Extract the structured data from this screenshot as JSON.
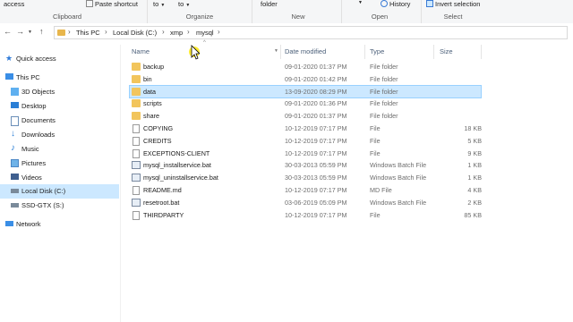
{
  "ribbon": {
    "access": "access",
    "paste_shortcut": "Paste shortcut",
    "to1": "to",
    "to2": "to",
    "folder": "folder",
    "history": "History",
    "invert_selection": "Invert selection",
    "groups": {
      "clipboard": "Clipboard",
      "organize": "Organize",
      "new": "New",
      "open": "Open",
      "select": "Select"
    }
  },
  "address": {
    "breadcrumbs": [
      "This PC",
      "Local Disk (C:)",
      "xmp",
      "mysql"
    ]
  },
  "nav": {
    "items": [
      {
        "label": "Quick access",
        "icon": "star-icon"
      },
      {
        "label": "This PC",
        "icon": "computer-icon"
      },
      {
        "label": "3D Objects",
        "icon": "cube-icon"
      },
      {
        "label": "Desktop",
        "icon": "desktop-icon"
      },
      {
        "label": "Documents",
        "icon": "documents-icon"
      },
      {
        "label": "Downloads",
        "icon": "download-icon"
      },
      {
        "label": "Music",
        "icon": "music-icon"
      },
      {
        "label": "Pictures",
        "icon": "pictures-icon"
      },
      {
        "label": "Videos",
        "icon": "video-icon"
      },
      {
        "label": "Local Disk (C:)",
        "icon": "drive-icon"
      },
      {
        "label": "SSD-GTX (S:)",
        "icon": "drive-icon"
      },
      {
        "label": "Network",
        "icon": "network-icon"
      }
    ]
  },
  "columns": {
    "name": "Name",
    "date": "Date modified",
    "type": "Type",
    "size": "Size"
  },
  "files": [
    {
      "name": "backup",
      "date": "09-01-2020 01:37 PM",
      "type": "File folder",
      "size": "",
      "kind": "folder"
    },
    {
      "name": "bin",
      "date": "09-01-2020 01:42 PM",
      "type": "File folder",
      "size": "",
      "kind": "folder"
    },
    {
      "name": "data",
      "date": "13-09-2020 08:29 PM",
      "type": "File folder",
      "size": "",
      "kind": "folder",
      "selected": true
    },
    {
      "name": "scripts",
      "date": "09-01-2020 01:36 PM",
      "type": "File folder",
      "size": "",
      "kind": "folder"
    },
    {
      "name": "share",
      "date": "09-01-2020 01:37 PM",
      "type": "File folder",
      "size": "",
      "kind": "folder"
    },
    {
      "name": "COPYING",
      "date": "10-12-2019 07:17 PM",
      "type": "File",
      "size": "18 KB",
      "kind": "file"
    },
    {
      "name": "CREDITS",
      "date": "10-12-2019 07:17 PM",
      "type": "File",
      "size": "5 KB",
      "kind": "file"
    },
    {
      "name": "EXCEPTIONS-CLIENT",
      "date": "10-12-2019 07:17 PM",
      "type": "File",
      "size": "9 KB",
      "kind": "file"
    },
    {
      "name": "mysql_installservice.bat",
      "date": "30-03-2013 05:59 PM",
      "type": "Windows Batch File",
      "size": "1 KB",
      "kind": "bat"
    },
    {
      "name": "mysql_uninstallservice.bat",
      "date": "30-03-2013 05:59 PM",
      "type": "Windows Batch File",
      "size": "1 KB",
      "kind": "bat"
    },
    {
      "name": "README.md",
      "date": "10-12-2019 07:17 PM",
      "type": "MD File",
      "size": "4 KB",
      "kind": "file"
    },
    {
      "name": "resetroot.bat",
      "date": "03-06-2019 05:09 PM",
      "type": "Windows Batch File",
      "size": "2 KB",
      "kind": "bat"
    },
    {
      "name": "THIRDPARTY",
      "date": "10-12-2019 07:17 PM",
      "type": "File",
      "size": "85 KB",
      "kind": "file"
    }
  ]
}
